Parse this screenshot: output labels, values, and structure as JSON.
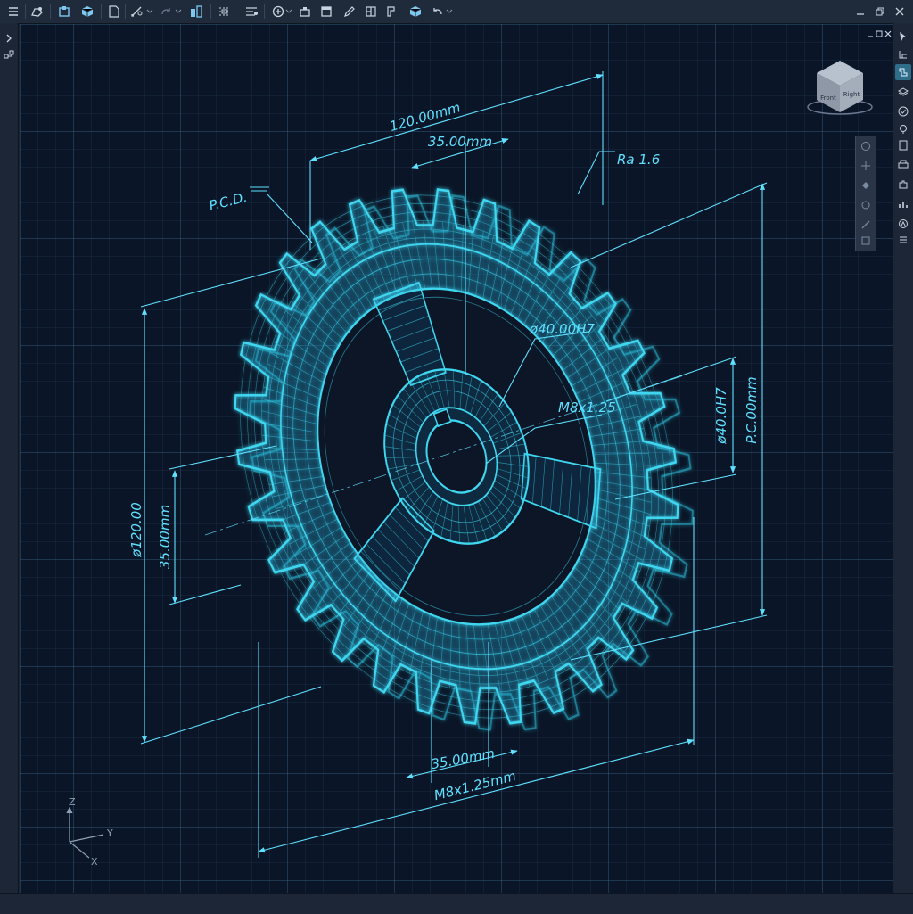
{
  "app": {
    "toolbar_icons": [
      "menu-icon",
      "open-icon",
      "part-icon",
      "assembly-icon",
      "new-document-icon",
      "sketch-icon",
      "redo-icon",
      "component-icon",
      "constraint-icon",
      "measure-icon",
      "extrude-icon",
      "layers-icon",
      "pencil-icon",
      "view-icon",
      "select-view-icon",
      "3d-box-icon",
      "undo-icon"
    ],
    "window_controls": [
      "minimize-icon",
      "restore-icon",
      "close-icon"
    ]
  },
  "viewport": {
    "view_cube": {
      "front_label": "Front",
      "right_label": "Right"
    },
    "axis_triad": {
      "z_label": "Z",
      "y_label": "Y",
      "x_label": "X"
    }
  },
  "drawing": {
    "dimensions": {
      "top_overall": "120.00mm",
      "top_inner": "35.00mm",
      "surface_finish": "Ra 1.6",
      "pcd_label": "P.C.D.",
      "bore_diameter": "ø40.00H7",
      "thread": "M8x1.25",
      "right_bore": "ø40.0H7",
      "right_pcd": "P.C.00mm",
      "left_diameter": "ø120.00",
      "left_inner": "35.00mm",
      "bottom_inner": "35.00mm",
      "bottom_thread": "M8x1.25mm"
    }
  },
  "colors": {
    "wire": "#3fd6f0",
    "dimension": "#5fe0ff",
    "background": "#0a1627"
  }
}
